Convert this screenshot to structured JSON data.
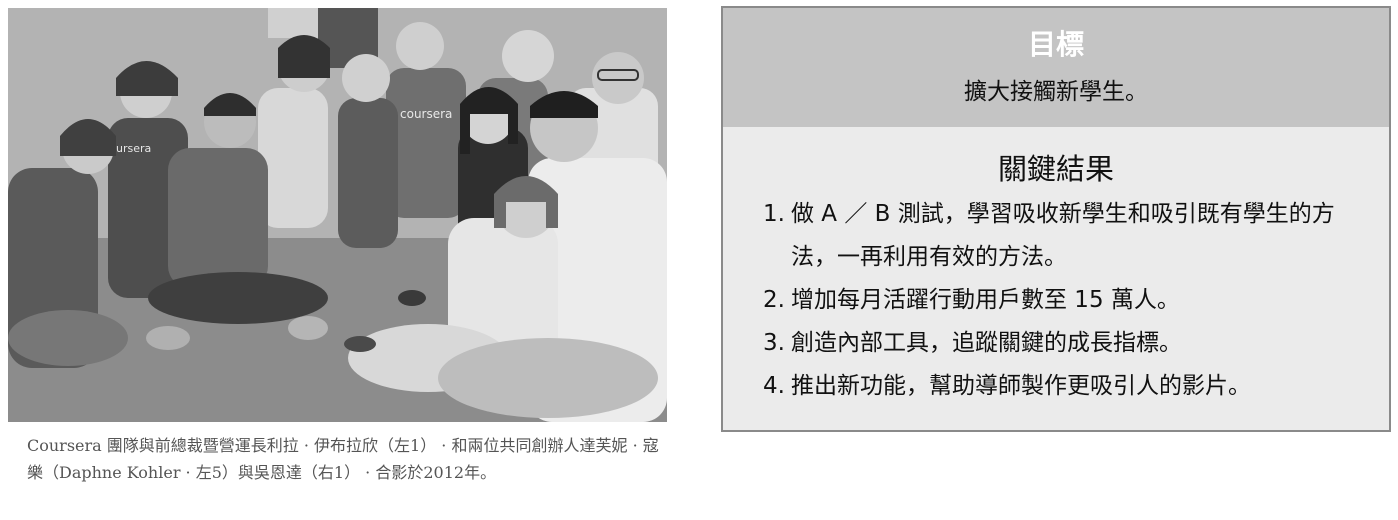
{
  "photo": {
    "alt": "Coursera team group photo",
    "shirt_text": "coursera",
    "shirt_text_2": "ursera"
  },
  "caption": {
    "text": "Coursera 團隊與前總裁暨營運長利拉 · 伊布拉欣（左1） · 和兩位共同創辦人達芙妮 · 寇樂（Daphne Kohler · 左5）與吳恩達（右1） · 合影於2012年。"
  },
  "okr": {
    "objective_heading": "目標",
    "objective_text": "擴大接觸新學生。",
    "key_results_heading": "關鍵結果",
    "key_results": [
      {
        "num": "1.",
        "text": "做 A ／ B 測試，學習吸收新學生和吸引既有學生的方法，一再利用有效的方法。"
      },
      {
        "num": "2.",
        "text": "增加每月活躍行動用戶數至 15 萬人。"
      },
      {
        "num": "3.",
        "text": "創造內部工具，追蹤關鍵的成長指標。"
      },
      {
        "num": "4.",
        "text": "推出新功能，幫助導師製作更吸引人的影片。"
      }
    ]
  }
}
